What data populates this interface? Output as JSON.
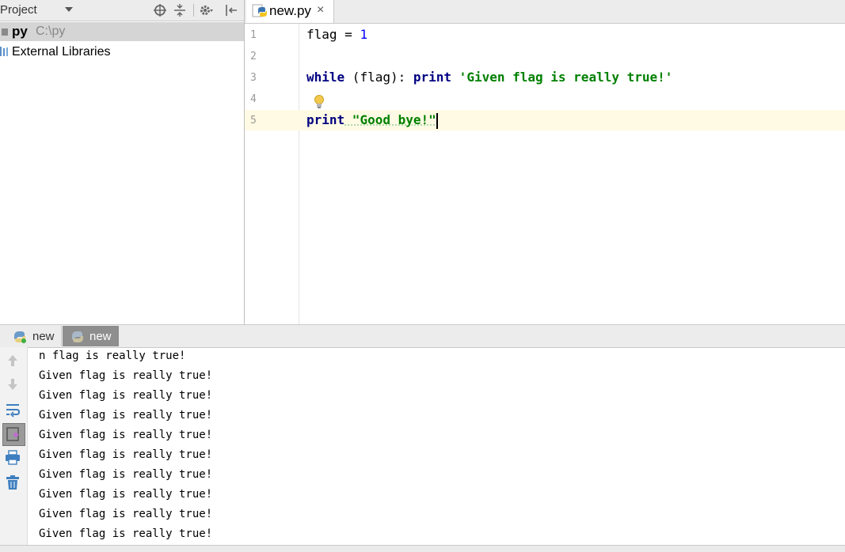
{
  "project_panel": {
    "title": "Project",
    "tree": [
      {
        "label": "py",
        "path": "C:\\py"
      },
      {
        "label": "External Libraries"
      }
    ]
  },
  "editor": {
    "tab": {
      "label": "new.py",
      "close": "×"
    },
    "lines": [
      {
        "num": "1"
      },
      {
        "num": "2"
      },
      {
        "num": "3"
      },
      {
        "num": "4"
      },
      {
        "num": "5"
      }
    ],
    "code": {
      "l1_name": "flag",
      "l1_op": " = ",
      "l1_val": "1",
      "l3_kw": "while",
      "l3_cond": " (flag): ",
      "l3_kw2": "print",
      "l3_str": " 'Given flag is really true!'",
      "l5_kw": "print",
      "l5_str": " \"Good bye!\""
    }
  },
  "run_panel": {
    "tabs": [
      {
        "label": "new"
      },
      {
        "label": "new"
      }
    ],
    "output": [
      "n flag is really true!",
      "Given flag is really true!",
      "Given flag is really true!",
      "Given flag is really true!",
      "Given flag is really true!",
      "Given flag is really true!",
      "Given flag is really true!",
      "Given flag is really true!",
      "Given flag is really true!",
      "Given flag is really true!"
    ]
  },
  "colors": {
    "keyword": "#000080",
    "string": "#008000",
    "number": "#0000ff",
    "current_line": "#fffae3"
  },
  "icons": [
    "crosshair-icon",
    "collapse-icon",
    "gear-icon",
    "hide-icon",
    "python-file-icon",
    "folder-icon",
    "libraries-icon",
    "lightbulb-icon",
    "up-arrow-icon",
    "down-arrow-icon",
    "soft-wrap-icon",
    "scroll-to-end-icon",
    "print-icon",
    "trash-icon"
  ]
}
